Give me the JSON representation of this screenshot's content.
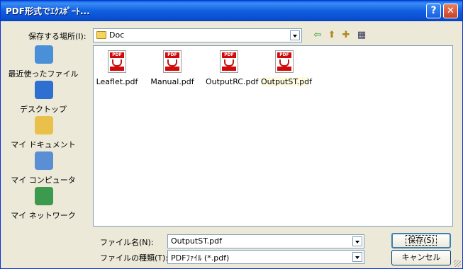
{
  "window": {
    "title": "PDF形式でｴｸｽﾎﾟｰﾄ..."
  },
  "titlebar_buttons": {
    "help": "?",
    "close": "✕"
  },
  "lookin": {
    "label": "保存する場所(I):",
    "value": "Doc"
  },
  "places": [
    {
      "label": "最近使ったファイル",
      "icon": "recent-icon",
      "color": "#4a90d9"
    },
    {
      "label": "デスクトップ",
      "icon": "desktop-icon",
      "color": "#2f6fd0"
    },
    {
      "label": "マイ ドキュメント",
      "icon": "my-documents-icon",
      "color": "#e8c04a"
    },
    {
      "label": "マイ コンピュータ",
      "icon": "my-computer-icon",
      "color": "#5a8fd6"
    },
    {
      "label": "マイ ネットワーク",
      "icon": "my-network-icon",
      "color": "#3b9a4e"
    }
  ],
  "files": [
    {
      "name": "Leaflet.pdf",
      "selected": false
    },
    {
      "name": "Manual.pdf",
      "selected": false
    },
    {
      "name": "OutputRC.pdf",
      "selected": false
    },
    {
      "name": "OutputST.pdf",
      "selected": true
    }
  ],
  "pdf_icon": {
    "tag": "PDF"
  },
  "filename": {
    "label": "ファイル名(N):",
    "value": "OutputST.pdf"
  },
  "filetype": {
    "label": "ファイルの種類(T):",
    "value": "PDFﾌｧｲﾙ (*.pdf)"
  },
  "buttons": {
    "save": "保存(S)",
    "cancel": "キャンセル"
  },
  "colors": {
    "titlebar": "#0a5fdc",
    "window_bg": "#ece9d8",
    "selection": "#fffbe0"
  }
}
